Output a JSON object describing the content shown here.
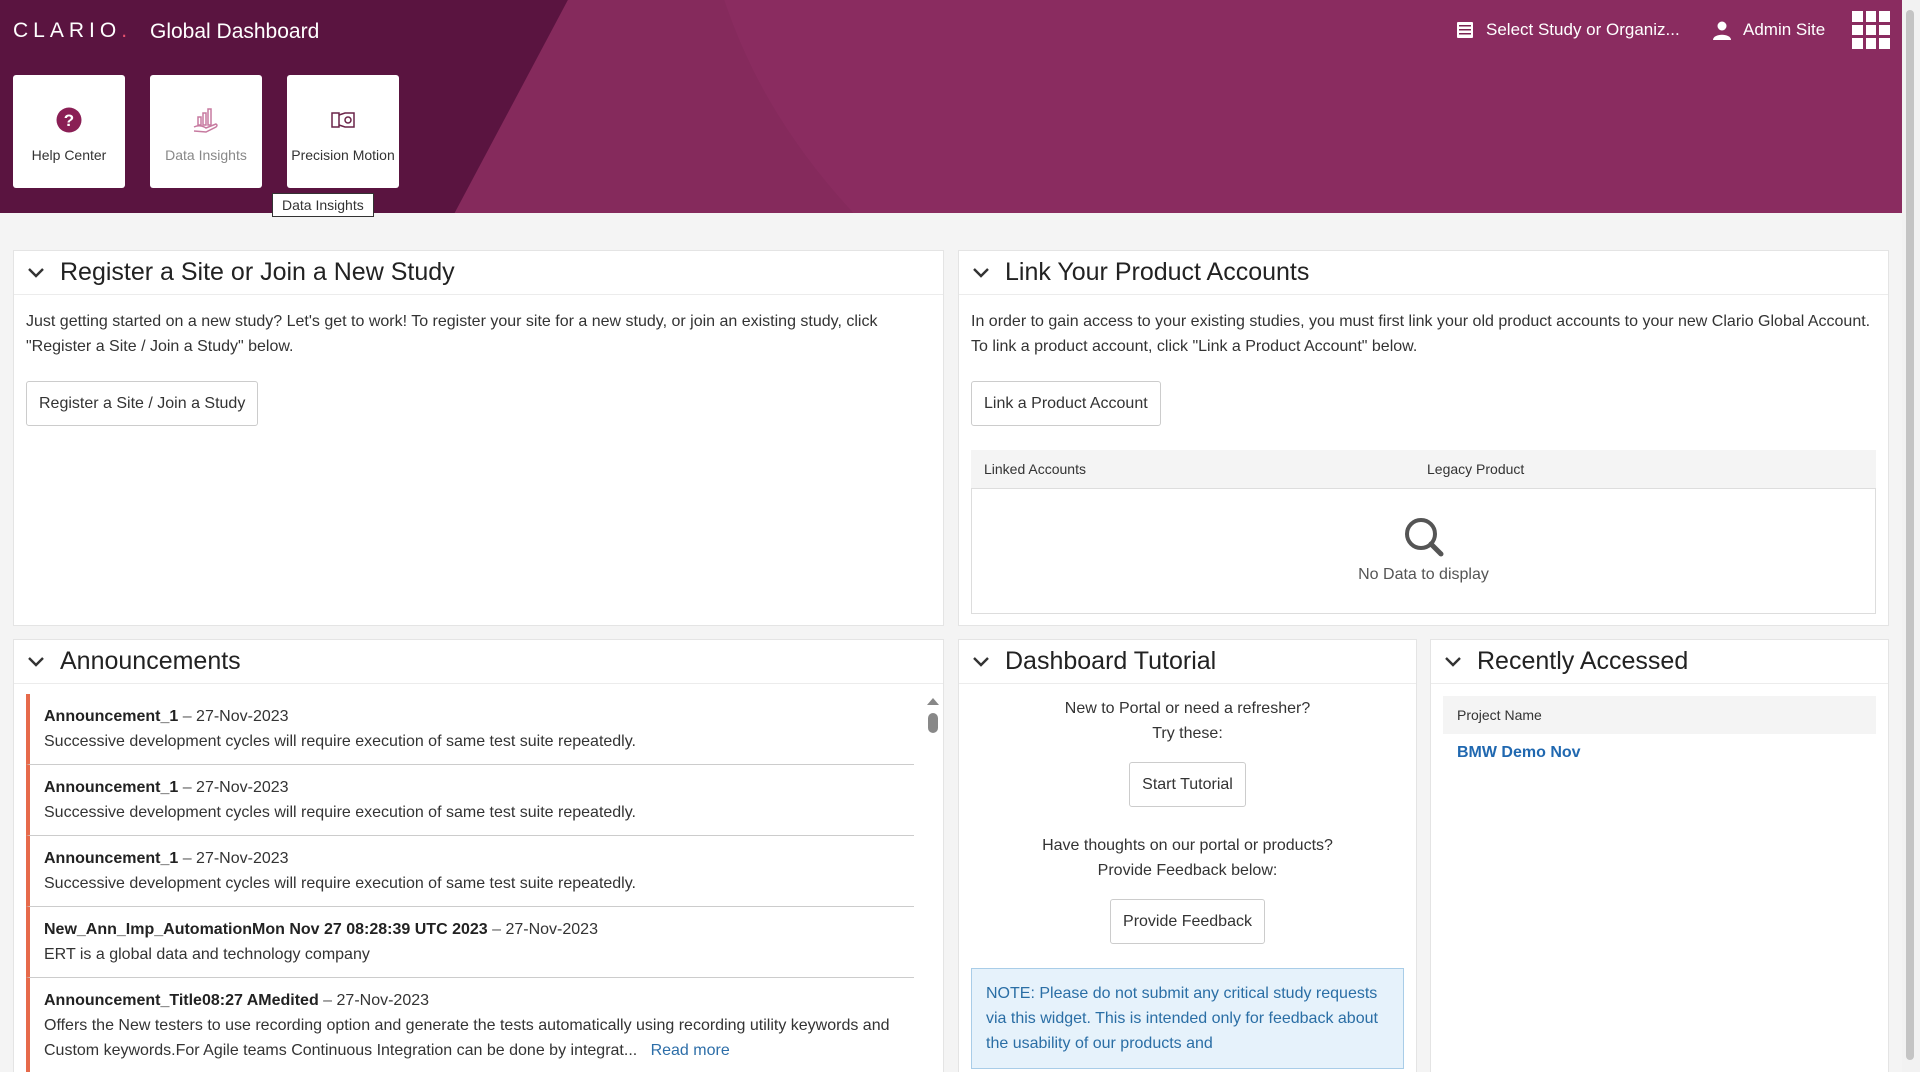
{
  "header": {
    "logo_text": "CLARIO",
    "logo_dot": ".",
    "app_title": "Global Dashboard",
    "study_select": "Select Study or Organiz...",
    "user": "Admin Site"
  },
  "tiles": [
    {
      "label": "Help Center",
      "icon": "question-circle-icon",
      "color": "#8a1f55"
    },
    {
      "label": "Data Insights",
      "icon": "chart-hand-icon",
      "color": "#c77aa0"
    },
    {
      "label": "Precision Motion",
      "icon": "motion-icon",
      "color": "#6a2448"
    }
  ],
  "tooltip": "Data Insights",
  "register": {
    "title": "Register a Site or Join a New Study",
    "text": "Just getting started on a new study? Let's get to work! To register your site for a new study, or join an existing study, click \"Register a Site / Join a Study\" below.",
    "button": "Register a Site / Join a Study"
  },
  "link_accounts": {
    "title": "Link Your Product Accounts",
    "text": "In order to gain access to your existing studies, you must first link your old product accounts to your new Clario Global Account. To link a product account, click \"Link a Product Account\" below.",
    "button": "Link a Product Account",
    "columns": [
      "Linked Accounts",
      "Legacy Product"
    ],
    "empty": "No Data to display"
  },
  "announcements": {
    "title": "Announcements",
    "items": [
      {
        "title": "Announcement_1",
        "sep": " – ",
        "date": "27-Nov-2023",
        "text": "Successive development cycles will require execution of same test suite repeatedly."
      },
      {
        "title": "Announcement_1",
        "sep": " – ",
        "date": "27-Nov-2023",
        "text": "Successive development cycles will require execution of same test suite repeatedly."
      },
      {
        "title": "Announcement_1",
        "sep": " – ",
        "date": "27-Nov-2023",
        "text": "Successive development cycles will require execution of same test suite repeatedly."
      },
      {
        "title": "New_Ann_Imp_AutomationMon Nov 27 08:28:39 UTC 2023",
        "sep": " – ",
        "date": "27-Nov-2023",
        "text": "ERT is a global data and technology company"
      },
      {
        "title": "Announcement_Title08:27 AMedited",
        "sep": " – ",
        "date": "27-Nov-2023",
        "text": "Offers the New testers to use recording option and generate the tests automatically using recording utility keywords and Custom keywords.For Agile teams Continuous Integration can be done by integrat...",
        "read_more": "Read more"
      }
    ]
  },
  "tutorial": {
    "title": "Dashboard Tutorial",
    "line1": "New to Portal or need a refresher?",
    "line2": "Try these:",
    "start_button": "Start Tutorial",
    "line3": "Have thoughts on our portal or products?",
    "line4": "Provide Feedback below:",
    "feedback_button": "Provide Feedback",
    "note": "NOTE: Please do not submit any critical study requests via this widget. This is intended only for feedback about the usability of our products and"
  },
  "recent": {
    "title": "Recently Accessed",
    "column": "Project Name",
    "items": [
      "BMW Demo Nov"
    ]
  }
}
